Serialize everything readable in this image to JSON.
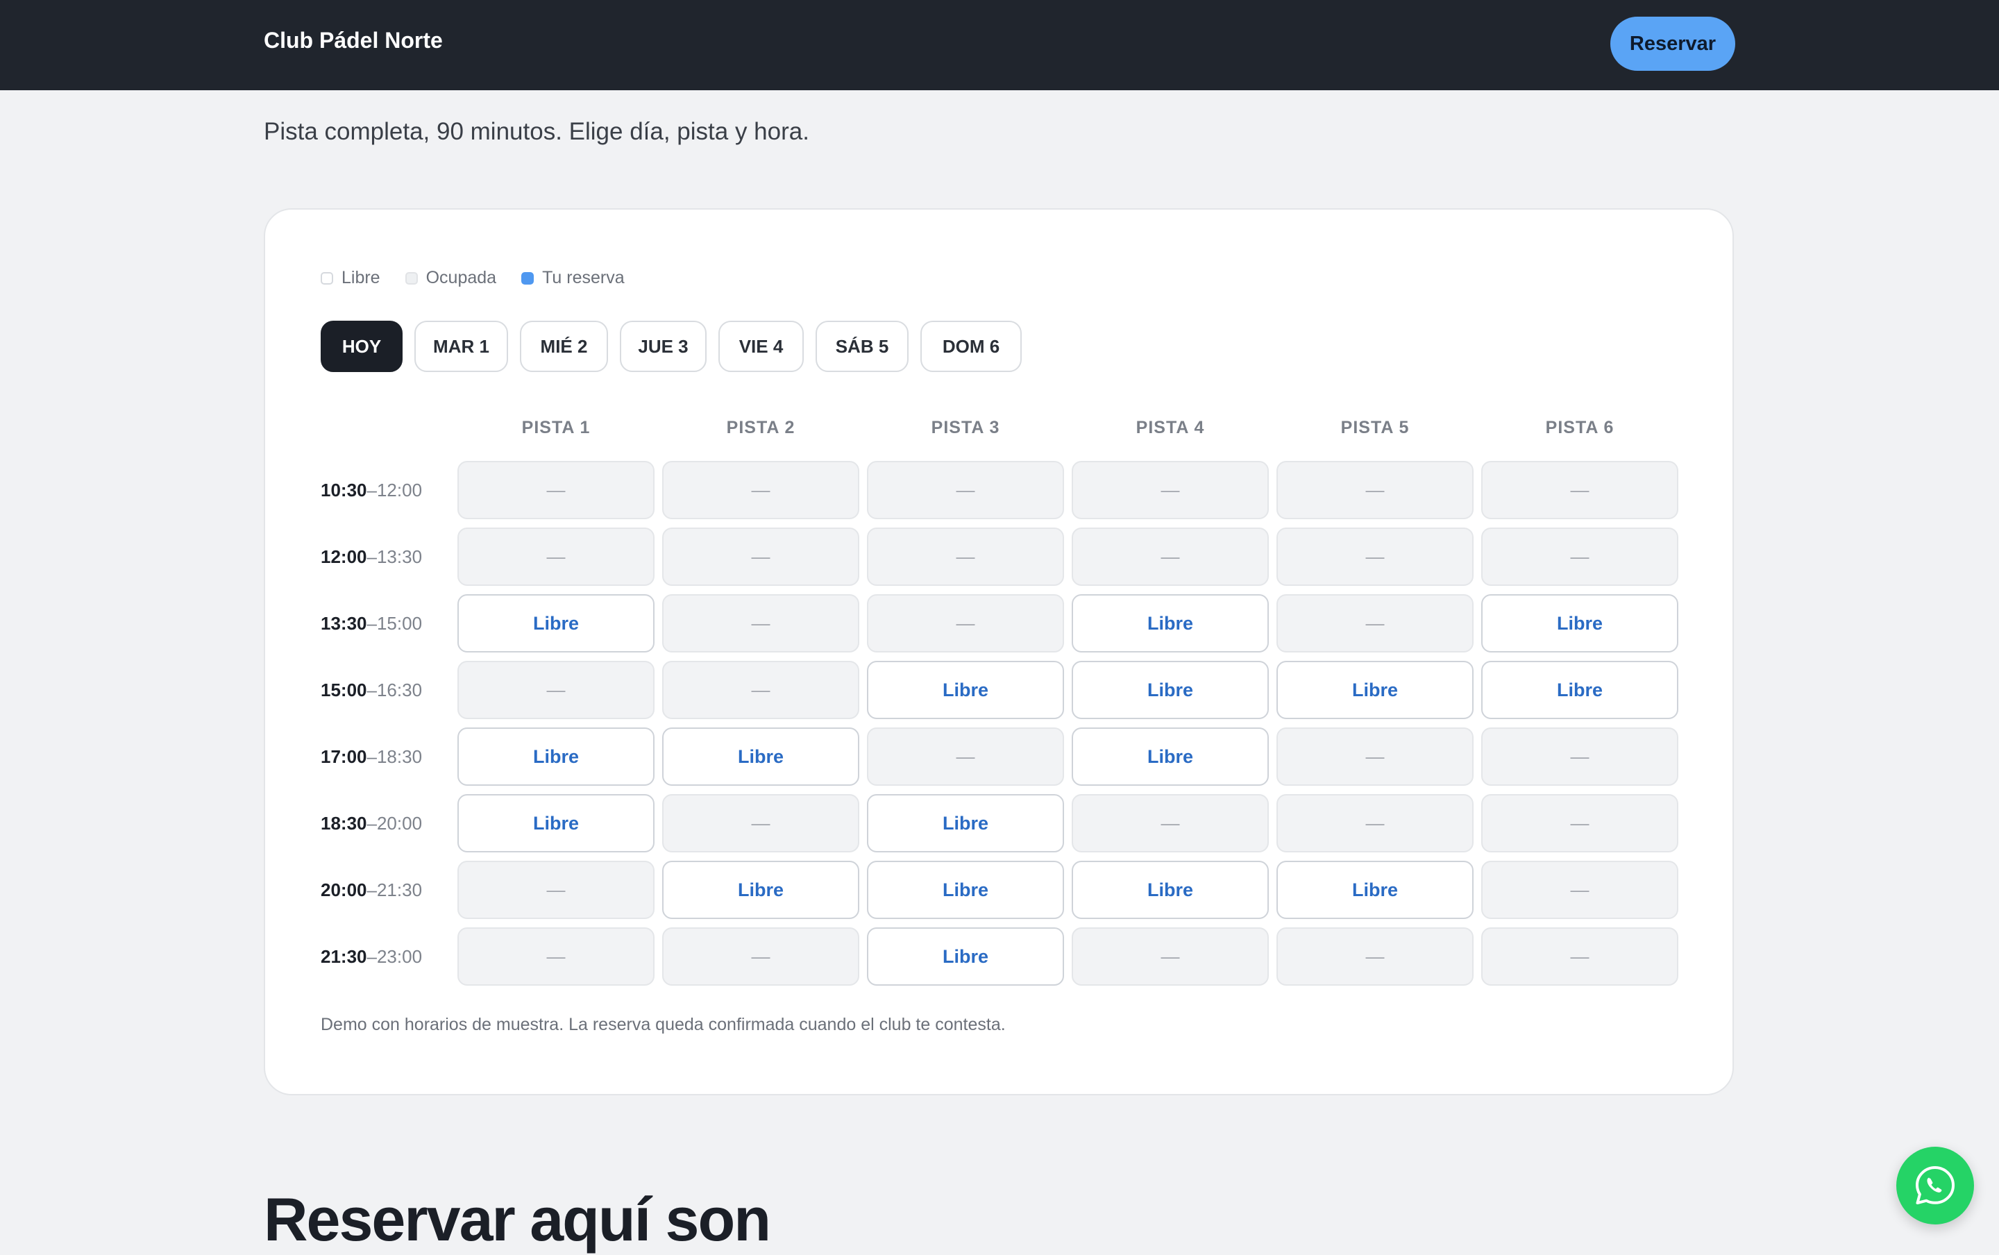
{
  "nav": {
    "brand": "Club Pádel Norte",
    "cta": "Reservar"
  },
  "hero": {
    "subtitle": "Pista completa, 90 minutos. Elige día, pista y hora."
  },
  "legend": [
    {
      "label": "Libre",
      "kind": "free"
    },
    {
      "label": "Ocupada",
      "kind": "busy"
    },
    {
      "label": "Tu reserva",
      "kind": "mine"
    }
  ],
  "days": [
    {
      "label": "HOY",
      "active": true
    },
    {
      "label": "MAR 1",
      "active": false
    },
    {
      "label": "MIÉ 2",
      "active": false
    },
    {
      "label": "JUE 3",
      "active": false
    },
    {
      "label": "VIE 4",
      "active": false
    },
    {
      "label": "SÁB 5",
      "active": false
    },
    {
      "label": "DOM 6",
      "active": false
    }
  ],
  "courts": [
    "PISTA 1",
    "PISTA 2",
    "PISTA 3",
    "PISTA 4",
    "PISTA 5",
    "PISTA 6"
  ],
  "labels": {
    "free": "Libre",
    "busy": "—"
  },
  "slots": [
    {
      "start": "10:30",
      "end": "–12:00",
      "status": [
        "busy",
        "busy",
        "busy",
        "busy",
        "busy",
        "busy"
      ]
    },
    {
      "start": "12:00",
      "end": "–13:30",
      "status": [
        "busy",
        "busy",
        "busy",
        "busy",
        "busy",
        "busy"
      ]
    },
    {
      "start": "13:30",
      "end": "–15:00",
      "status": [
        "free",
        "busy",
        "busy",
        "free",
        "busy",
        "free"
      ]
    },
    {
      "start": "15:00",
      "end": "–16:30",
      "status": [
        "busy",
        "busy",
        "free",
        "free",
        "free",
        "free"
      ]
    },
    {
      "start": "17:00",
      "end": "–18:30",
      "status": [
        "free",
        "free",
        "busy",
        "free",
        "busy",
        "busy"
      ]
    },
    {
      "start": "18:30",
      "end": "–20:00",
      "status": [
        "free",
        "busy",
        "free",
        "busy",
        "busy",
        "busy"
      ]
    },
    {
      "start": "20:00",
      "end": "–21:30",
      "status": [
        "busy",
        "free",
        "free",
        "free",
        "free",
        "busy"
      ]
    },
    {
      "start": "21:30",
      "end": "–23:00",
      "status": [
        "busy",
        "busy",
        "free",
        "busy",
        "busy",
        "busy"
      ]
    }
  ],
  "footnote": "Demo con horarios de muestra. La reserva queda confirmada cuando el club te contesta.",
  "section": {
    "heading": "Reservar aquí son"
  },
  "colors": {
    "nav_bg": "#20252d",
    "accent": "#5aa4f5",
    "free_text": "#2a6bc4",
    "mine": "#4f98f0",
    "whatsapp": "#25d366"
  },
  "icons": {
    "whatsapp": "whatsapp-icon"
  }
}
